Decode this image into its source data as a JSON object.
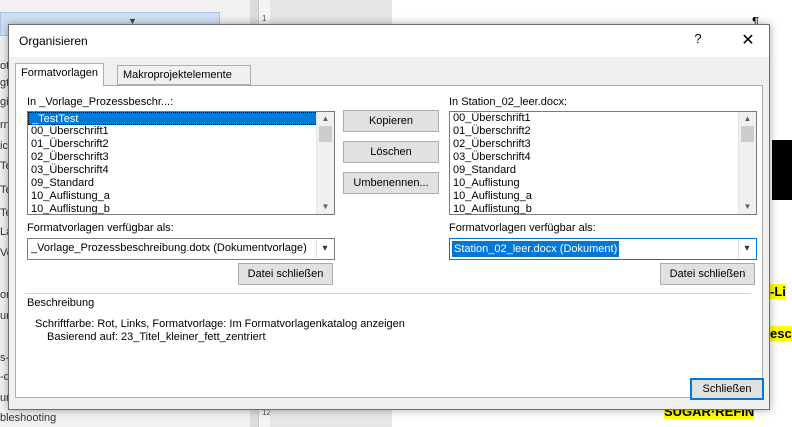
{
  "background": {
    "left_rows": [
      "ot",
      "gt",
      "gi",
      "rn",
      "ic",
      "Te",
      "Te",
      "Te",
      "La",
      "Ve",
      "or",
      "ur",
      "s-",
      "-d",
      "ur",
      "bleshooting"
    ],
    "page_texts": {
      "pilcrow": "¶",
      "hl1": "-Li",
      "hl2": "esc",
      "hl3": "SUGAR·REFIN"
    },
    "ruler_marks": [
      "1",
      "12"
    ]
  },
  "dialog": {
    "title": "Organisieren",
    "help": "?",
    "close": "✕",
    "tabs": [
      {
        "label": "Formatvorlagen",
        "active": true
      },
      {
        "label": "Makroprojektelemente",
        "active": false
      }
    ],
    "left": {
      "label": "In _Vorlage_Prozessbeschr...:",
      "items": [
        "_TestTest",
        "00_Überschrift1",
        "01_Überschrift2",
        "02_Überschrift3",
        "03_Überschrift4",
        "09_Standard",
        "10_Auflistung_a",
        "10_Auflistung_b"
      ],
      "selected_index": 0,
      "available_label": "Formatvorlagen verfügbar als:",
      "available_value": "_Vorlage_Prozessbeschreibung.dotx (Dokumentvorlage)",
      "close_file": "Datei schließen"
    },
    "right": {
      "label": "In Station_02_leer.docx:",
      "items": [
        "00_Überschrift1",
        "01_Überschrift2",
        "02_Überschrift3",
        "03_Überschrift4",
        "09_Standard",
        "10_Auflistung",
        "10_Auflistung_a",
        "10_Auflistung_b"
      ],
      "available_label": "Formatvorlagen verfügbar als:",
      "available_value": "Station_02_leer.docx (Dokument)",
      "close_file": "Datei schließen"
    },
    "buttons": {
      "copy": "Kopieren",
      "delete": "Löschen",
      "rename": "Umbenennen..."
    },
    "description": {
      "heading": "Beschreibung",
      "line1": "Schriftfarbe: Rot, Links, Formatvorlage: Im Formatvorlagenkatalog anzeigen",
      "line2": "Basierend auf: 23_Titel_kleiner_fett_zentriert"
    },
    "close_button": "Schließen"
  },
  "colors": {
    "selection": "#0078d7",
    "dialog_bg": "#f0f0f0",
    "highlight": "#ffff00"
  },
  "icons": {
    "scroll_up": "▲",
    "scroll_down": "▼",
    "dropdown": "▾"
  }
}
